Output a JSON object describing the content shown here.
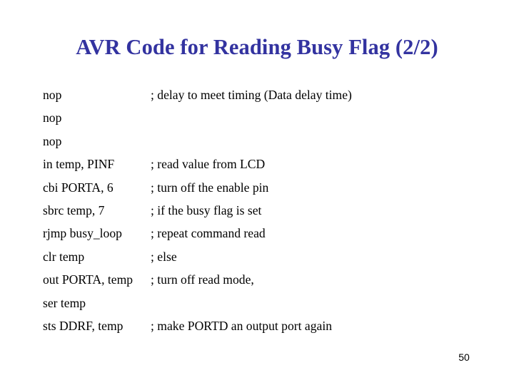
{
  "slide": {
    "title": "AVR Code for Reading Busy Flag (2/2)",
    "title_color": "#3333a0",
    "background_color": "#ffffff",
    "text_color": "#000000",
    "page_number": "50"
  },
  "code": {
    "lines": [
      {
        "mnemonic": "nop",
        "comment": "; delay to meet timing (Data delay time)"
      },
      {
        "mnemonic": "nop",
        "comment": ""
      },
      {
        "mnemonic": "nop",
        "comment": ""
      },
      {
        "mnemonic": "in temp, PINF",
        "comment": "; read value from LCD"
      },
      {
        "mnemonic": "cbi PORTA, 6",
        "comment": "; turn off the enable pin"
      },
      {
        "mnemonic": "sbrc temp, 7",
        "comment": "; if the busy flag is set"
      },
      {
        "mnemonic": "rjmp busy_loop",
        "comment": "; repeat command read"
      },
      {
        "mnemonic": "clr temp",
        "comment": "; else"
      },
      {
        "mnemonic": "out PORTA, temp",
        "comment": "; turn off read mode,"
      },
      {
        "mnemonic": "ser temp",
        "comment": ""
      },
      {
        "mnemonic": "sts DDRF, temp",
        "comment": "; make PORTD an output port again"
      }
    ]
  }
}
